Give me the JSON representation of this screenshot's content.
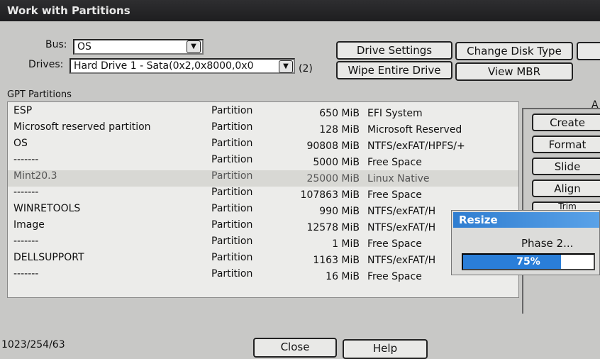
{
  "window": {
    "title": "Work with Partitions"
  },
  "bus": {
    "label": "Bus:",
    "value": "OS"
  },
  "drives": {
    "label": "Drives:",
    "value": "Hard Drive 1 - Sata(0x2,0x8000,0x0",
    "count": "(2)"
  },
  "buttons": {
    "drive_settings": "Drive Settings",
    "change_disk_type": "Change Disk Type",
    "wipe_entire_drive": "Wipe Entire Drive",
    "view_mbr": "View MBR",
    "close": "Close",
    "help": "Help"
  },
  "partitions": {
    "group_label": "GPT Partitions",
    "rows": [
      {
        "name": "ESP",
        "type": "Partition",
        "size": "650 MiB",
        "fs": "EFI System"
      },
      {
        "name": "Microsoft reserved partition",
        "type": "Partition",
        "size": "128 MiB",
        "fs": "Microsoft Reserved"
      },
      {
        "name": "OS",
        "type": "Partition",
        "size": "90808 MiB",
        "fs": "NTFS/exFAT/HPFS/+"
      },
      {
        "name": "-------",
        "type": "Partition",
        "size": "5000 MiB",
        "fs": "Free Space"
      },
      {
        "name": "Mint20.3",
        "type": "Partition",
        "size": "25000 MiB",
        "fs": "Linux Native"
      },
      {
        "name": "-------",
        "type": "Partition",
        "size": "107863 MiB",
        "fs": "Free Space"
      },
      {
        "name": "WINRETOOLS",
        "type": "Partition",
        "size": "990 MiB",
        "fs": "NTFS/exFAT/H"
      },
      {
        "name": "Image",
        "type": "Partition",
        "size": "12578 MiB",
        "fs": "NTFS/exFAT/H"
      },
      {
        "name": "-------",
        "type": "Partition",
        "size": "1 MiB",
        "fs": "Free Space"
      },
      {
        "name": "DELLSUPPORT",
        "type": "Partition",
        "size": "1163 MiB",
        "fs": "NTFS/exFAT/H"
      },
      {
        "name": "-------",
        "type": "Partition",
        "size": "16 MiB",
        "fs": "Free Space"
      }
    ]
  },
  "actions": {
    "group_label": "A",
    "create": "Create",
    "format": "Format",
    "slide": "Slide",
    "align": "Align",
    "trim": "Trim"
  },
  "resize_dialog": {
    "title": "Resize",
    "phase": "Phase 2...",
    "progress_text": "75%",
    "progress": 0.75
  },
  "status": {
    "geometry": "1023/254/63"
  }
}
